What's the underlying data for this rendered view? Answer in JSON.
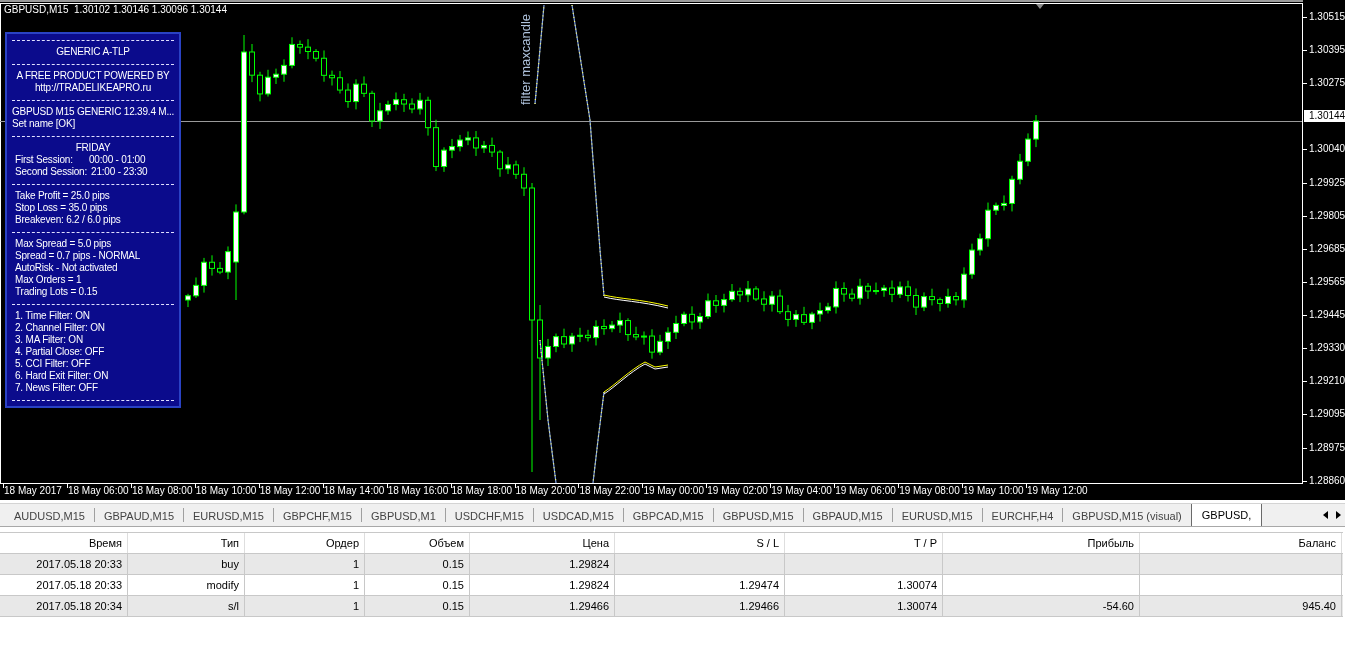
{
  "chart": {
    "title": "GBPUSD,M15  1.30102 1.30146 1.30096 1.30144",
    "indicator_label": "filter maxcandle",
    "price_axis": [
      {
        "text": "1.30515",
        "current": false
      },
      {
        "text": "1.30395",
        "current": false
      },
      {
        "text": "1.30275",
        "current": false
      },
      {
        "text": "1.30144",
        "current": true
      },
      {
        "text": "1.30040",
        "current": false
      },
      {
        "text": "1.29925",
        "current": false
      },
      {
        "text": "1.29805",
        "current": false
      },
      {
        "text": "1.29685",
        "current": false
      },
      {
        "text": "1.29565",
        "current": false
      },
      {
        "text": "1.29445",
        "current": false
      },
      {
        "text": "1.29330",
        "current": false
      },
      {
        "text": "1.29210",
        "current": false
      },
      {
        "text": "1.29095",
        "current": false
      },
      {
        "text": "1.28975",
        "current": false
      },
      {
        "text": "1.28860",
        "current": false
      }
    ],
    "time_axis": [
      "18 May 2017",
      "18 May 06:00",
      "18 May 08:00",
      "18 May 10:00",
      "18 May 12:00",
      "18 May 14:00",
      "18 May 16:00",
      "18 May 18:00",
      "18 May 20:00",
      "18 May 22:00",
      "19 May 00:00",
      "19 May 02:00",
      "19 May 04:00",
      "19 May 06:00",
      "19 May 08:00",
      "19 May 10:00",
      "19 May 12:00"
    ]
  },
  "info_panel": {
    "sections": [
      [
        {
          "kind": "centered",
          "text": "GENERIC A-TLP"
        }
      ],
      [
        {
          "kind": "centered",
          "text": "A FREE PRODUCT POWERED BY"
        },
        {
          "kind": "centered",
          "text": "http://TRADELIKEAPRO.ru"
        }
      ],
      [
        {
          "kind": "flush",
          "text": "GBPUSD M15 GENERIC 12.39.4 M..."
        },
        {
          "kind": "flush",
          "text": "Set name [OK]"
        }
      ],
      [
        {
          "kind": "centered",
          "text": "FRIDAY"
        },
        {
          "kind": "session",
          "label": "First Session:",
          "value": "00:00 - 01:00"
        },
        {
          "kind": "session",
          "label": "Second Session:",
          "value": "21:00 - 23:30"
        }
      ],
      [
        {
          "kind": "indented",
          "text": "Take Profit = 25.0 pips"
        },
        {
          "kind": "indented",
          "text": "Stop Loss = 35.0 pips"
        },
        {
          "kind": "indented",
          "text": "Breakeven: 6.2 / 6.0 pips"
        }
      ],
      [
        {
          "kind": "indented",
          "text": "Max Spread = 5.0 pips"
        },
        {
          "kind": "indented",
          "text": "Spread = 0.7 pips - NORMAL"
        },
        {
          "kind": "indented",
          "text": "AutoRisk - Not activated"
        },
        {
          "kind": "indented",
          "text": "Max Orders = 1"
        },
        {
          "kind": "indented",
          "text": "Trading Lots = 0.15"
        }
      ],
      [
        {
          "kind": "indented",
          "text": "1. Time Filter: ON"
        },
        {
          "kind": "indented",
          "text": "2. Channel Filter: ON"
        },
        {
          "kind": "indented",
          "text": "3. MA Filter: ON"
        },
        {
          "kind": "indented",
          "text": "4. Partial Close: OFF"
        },
        {
          "kind": "indented",
          "text": "5. CCI Filter: OFF"
        },
        {
          "kind": "indented",
          "text": "6. Hard Exit Filter: ON"
        },
        {
          "kind": "indented",
          "text": "7. News Filter: OFF"
        }
      ]
    ]
  },
  "tabs": [
    {
      "label": "AUDUSD,M15",
      "selected": false
    },
    {
      "label": "GBPAUD,M15",
      "selected": false
    },
    {
      "label": "EURUSD,M15",
      "selected": false
    },
    {
      "label": "GBPCHF,M15",
      "selected": false
    },
    {
      "label": "GBPUSD,M1",
      "selected": false
    },
    {
      "label": "USDCHF,M15",
      "selected": false
    },
    {
      "label": "USDCAD,M15",
      "selected": false
    },
    {
      "label": "GBPCAD,M15",
      "selected": false
    },
    {
      "label": "GBPUSD,M15",
      "selected": false
    },
    {
      "label": "GBPAUD,M15",
      "selected": false
    },
    {
      "label": "EURUSD,M15",
      "selected": false
    },
    {
      "label": "EURCHF,H4",
      "selected": false
    },
    {
      "label": "GBPUSD,M15 (visual)",
      "selected": false
    },
    {
      "label": "GBPUSD,",
      "selected": true
    }
  ],
  "table": {
    "columns": [
      "Время",
      "Тип",
      "Ордер",
      "Объем",
      "Цена",
      "S / L",
      "T / P",
      "Прибыль",
      "Баланс"
    ],
    "rows": [
      {
        "time": "2017.05.18 20:33",
        "type": "buy",
        "order": "1",
        "volume": "0.15",
        "price": "1.29824"
      },
      {
        "time": "2017.05.18 20:33",
        "type": "modify",
        "order": "1",
        "volume": "0.15",
        "price": "1.29824",
        "sl": "1.29474",
        "tp": "1.30074"
      },
      {
        "time": "2017.05.18 20:34",
        "type": "s/l",
        "order": "1",
        "volume": "0.15",
        "price": "1.29466",
        "sl": "1.29466",
        "tp": "1.30074",
        "profit": "-54.60",
        "balance": "945.40"
      }
    ]
  }
}
